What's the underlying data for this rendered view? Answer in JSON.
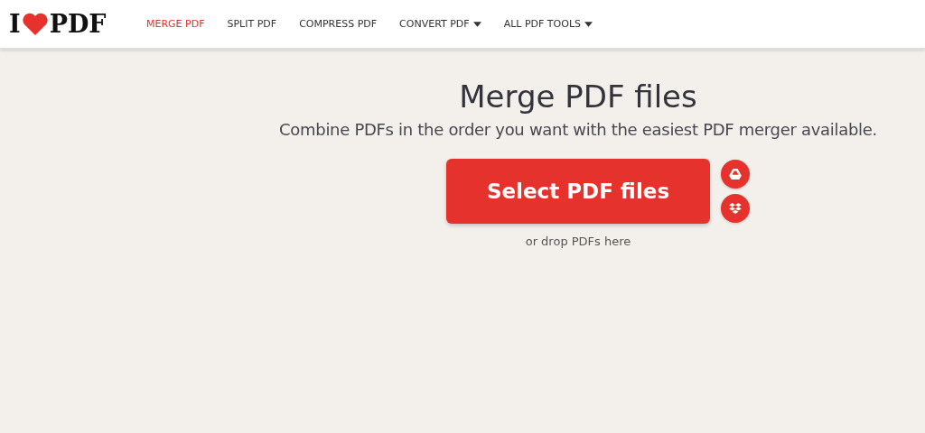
{
  "logo": {
    "left": "I",
    "right": "PDF"
  },
  "nav": [
    {
      "label": "MERGE PDF",
      "selected": true,
      "has_menu": false
    },
    {
      "label": "SPLIT PDF",
      "selected": false,
      "has_menu": false
    },
    {
      "label": "COMPRESS PDF",
      "selected": false,
      "has_menu": false
    },
    {
      "label": "CONVERT PDF",
      "selected": false,
      "has_menu": true
    },
    {
      "label": "ALL PDF TOOLS",
      "selected": false,
      "has_menu": true
    }
  ],
  "hero": {
    "title": "Merge PDF files",
    "subtitle": "Combine PDFs in the order you want with the easiest PDF merger available.",
    "button": "Select PDF files",
    "hint": "or drop PDFs here"
  }
}
